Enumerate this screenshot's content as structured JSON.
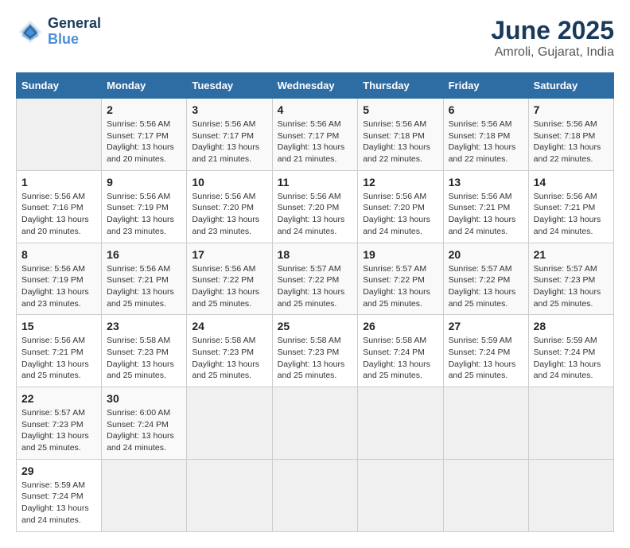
{
  "header": {
    "logo_line1": "General",
    "logo_line2": "Blue",
    "title": "June 2025",
    "subtitle": "Amroli, Gujarat, India"
  },
  "calendar": {
    "columns": [
      "Sunday",
      "Monday",
      "Tuesday",
      "Wednesday",
      "Thursday",
      "Friday",
      "Saturday"
    ],
    "weeks": [
      [
        null,
        {
          "day": "2",
          "sunrise": "Sunrise: 5:56 AM",
          "sunset": "Sunset: 7:17 PM",
          "daylight": "Daylight: 13 hours and 20 minutes."
        },
        {
          "day": "3",
          "sunrise": "Sunrise: 5:56 AM",
          "sunset": "Sunset: 7:17 PM",
          "daylight": "Daylight: 13 hours and 21 minutes."
        },
        {
          "day": "4",
          "sunrise": "Sunrise: 5:56 AM",
          "sunset": "Sunset: 7:17 PM",
          "daylight": "Daylight: 13 hours and 21 minutes."
        },
        {
          "day": "5",
          "sunrise": "Sunrise: 5:56 AM",
          "sunset": "Sunset: 7:18 PM",
          "daylight": "Daylight: 13 hours and 22 minutes."
        },
        {
          "day": "6",
          "sunrise": "Sunrise: 5:56 AM",
          "sunset": "Sunset: 7:18 PM",
          "daylight": "Daylight: 13 hours and 22 minutes."
        },
        {
          "day": "7",
          "sunrise": "Sunrise: 5:56 AM",
          "sunset": "Sunset: 7:18 PM",
          "daylight": "Daylight: 13 hours and 22 minutes."
        }
      ],
      [
        {
          "day": "1",
          "sunrise": "Sunrise: 5:56 AM",
          "sunset": "Sunset: 7:16 PM",
          "daylight": "Daylight: 13 hours and 20 minutes."
        },
        {
          "day": "9",
          "sunrise": "Sunrise: 5:56 AM",
          "sunset": "Sunset: 7:19 PM",
          "daylight": "Daylight: 13 hours and 23 minutes."
        },
        {
          "day": "10",
          "sunrise": "Sunrise: 5:56 AM",
          "sunset": "Sunset: 7:20 PM",
          "daylight": "Daylight: 13 hours and 23 minutes."
        },
        {
          "day": "11",
          "sunrise": "Sunrise: 5:56 AM",
          "sunset": "Sunset: 7:20 PM",
          "daylight": "Daylight: 13 hours and 24 minutes."
        },
        {
          "day": "12",
          "sunrise": "Sunrise: 5:56 AM",
          "sunset": "Sunset: 7:20 PM",
          "daylight": "Daylight: 13 hours and 24 minutes."
        },
        {
          "day": "13",
          "sunrise": "Sunrise: 5:56 AM",
          "sunset": "Sunset: 7:21 PM",
          "daylight": "Daylight: 13 hours and 24 minutes."
        },
        {
          "day": "14",
          "sunrise": "Sunrise: 5:56 AM",
          "sunset": "Sunset: 7:21 PM",
          "daylight": "Daylight: 13 hours and 24 minutes."
        }
      ],
      [
        {
          "day": "8",
          "sunrise": "Sunrise: 5:56 AM",
          "sunset": "Sunset: 7:19 PM",
          "daylight": "Daylight: 13 hours and 23 minutes."
        },
        {
          "day": "16",
          "sunrise": "Sunrise: 5:56 AM",
          "sunset": "Sunset: 7:21 PM",
          "daylight": "Daylight: 13 hours and 25 minutes."
        },
        {
          "day": "17",
          "sunrise": "Sunrise: 5:56 AM",
          "sunset": "Sunset: 7:22 PM",
          "daylight": "Daylight: 13 hours and 25 minutes."
        },
        {
          "day": "18",
          "sunrise": "Sunrise: 5:57 AM",
          "sunset": "Sunset: 7:22 PM",
          "daylight": "Daylight: 13 hours and 25 minutes."
        },
        {
          "day": "19",
          "sunrise": "Sunrise: 5:57 AM",
          "sunset": "Sunset: 7:22 PM",
          "daylight": "Daylight: 13 hours and 25 minutes."
        },
        {
          "day": "20",
          "sunrise": "Sunrise: 5:57 AM",
          "sunset": "Sunset: 7:22 PM",
          "daylight": "Daylight: 13 hours and 25 minutes."
        },
        {
          "day": "21",
          "sunrise": "Sunrise: 5:57 AM",
          "sunset": "Sunset: 7:23 PM",
          "daylight": "Daylight: 13 hours and 25 minutes."
        }
      ],
      [
        {
          "day": "15",
          "sunrise": "Sunrise: 5:56 AM",
          "sunset": "Sunset: 7:21 PM",
          "daylight": "Daylight: 13 hours and 25 minutes."
        },
        {
          "day": "23",
          "sunrise": "Sunrise: 5:58 AM",
          "sunset": "Sunset: 7:23 PM",
          "daylight": "Daylight: 13 hours and 25 minutes."
        },
        {
          "day": "24",
          "sunrise": "Sunrise: 5:58 AM",
          "sunset": "Sunset: 7:23 PM",
          "daylight": "Daylight: 13 hours and 25 minutes."
        },
        {
          "day": "25",
          "sunrise": "Sunrise: 5:58 AM",
          "sunset": "Sunset: 7:23 PM",
          "daylight": "Daylight: 13 hours and 25 minutes."
        },
        {
          "day": "26",
          "sunrise": "Sunrise: 5:58 AM",
          "sunset": "Sunset: 7:24 PM",
          "daylight": "Daylight: 13 hours and 25 minutes."
        },
        {
          "day": "27",
          "sunrise": "Sunrise: 5:59 AM",
          "sunset": "Sunset: 7:24 PM",
          "daylight": "Daylight: 13 hours and 25 minutes."
        },
        {
          "day": "28",
          "sunrise": "Sunrise: 5:59 AM",
          "sunset": "Sunset: 7:24 PM",
          "daylight": "Daylight: 13 hours and 24 minutes."
        }
      ],
      [
        {
          "day": "22",
          "sunrise": "Sunrise: 5:57 AM",
          "sunset": "Sunset: 7:23 PM",
          "daylight": "Daylight: 13 hours and 25 minutes."
        },
        {
          "day": "30",
          "sunrise": "Sunrise: 6:00 AM",
          "sunset": "Sunset: 7:24 PM",
          "daylight": "Daylight: 13 hours and 24 minutes."
        },
        null,
        null,
        null,
        null,
        null
      ],
      [
        {
          "day": "29",
          "sunrise": "Sunrise: 5:59 AM",
          "sunset": "Sunset: 7:24 PM",
          "daylight": "Daylight: 13 hours and 24 minutes."
        },
        null,
        null,
        null,
        null,
        null,
        null
      ]
    ]
  }
}
